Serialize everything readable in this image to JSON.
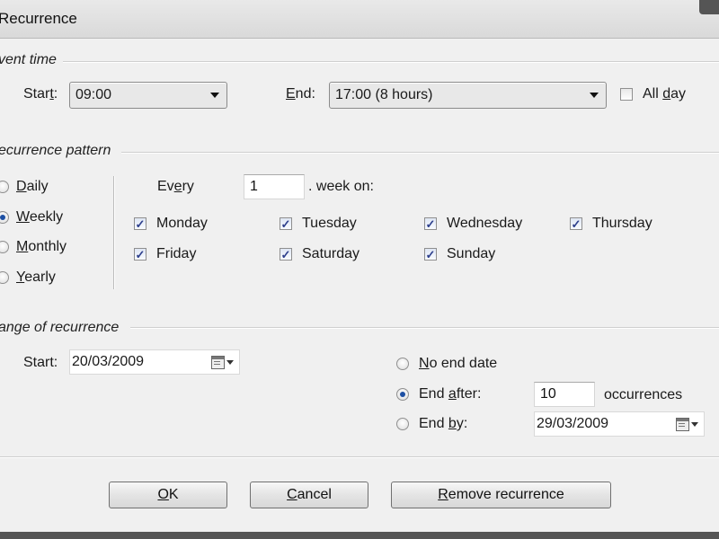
{
  "window": {
    "title": "Recurrence"
  },
  "event_time": {
    "title": "vent time",
    "start_label": "Start:",
    "start_value": "09:00",
    "end_label": "End:",
    "end_value": "17:00 (8 hours)",
    "all_day_label": "All day",
    "all_day_checked": false
  },
  "pattern": {
    "title": "ecurrence pattern",
    "options": [
      {
        "label": "Daily",
        "selected": false
      },
      {
        "label": "Weekly",
        "selected": true
      },
      {
        "label": "Monthly",
        "selected": false
      },
      {
        "label": "Yearly",
        "selected": false
      }
    ],
    "every_label": "Every",
    "every_value": "1",
    "week_on_label": ". week on:",
    "days": [
      {
        "label": "Monday",
        "checked": true
      },
      {
        "label": "Tuesday",
        "checked": true
      },
      {
        "label": "Wednesday",
        "checked": true
      },
      {
        "label": "Thursday",
        "checked": true
      },
      {
        "label": "Friday",
        "checked": true
      },
      {
        "label": "Saturday",
        "checked": true
      },
      {
        "label": "Sunday",
        "checked": true
      }
    ]
  },
  "range": {
    "title": "ange of recurrence",
    "start_label": "Start:",
    "start_value": "20/03/2009",
    "no_end_label": "No end date",
    "end_after_label": "End after:",
    "end_after_value": "10",
    "occurrences_label": "occurrences",
    "end_by_label": "End by:",
    "end_by_value": "29/03/2009",
    "selected": "end_after"
  },
  "buttons": {
    "ok": "OK",
    "cancel": "Cancel",
    "remove": "Remove recurrence"
  },
  "colors": {
    "accent": "#1d4fa3",
    "background": "#f0f0f0"
  }
}
